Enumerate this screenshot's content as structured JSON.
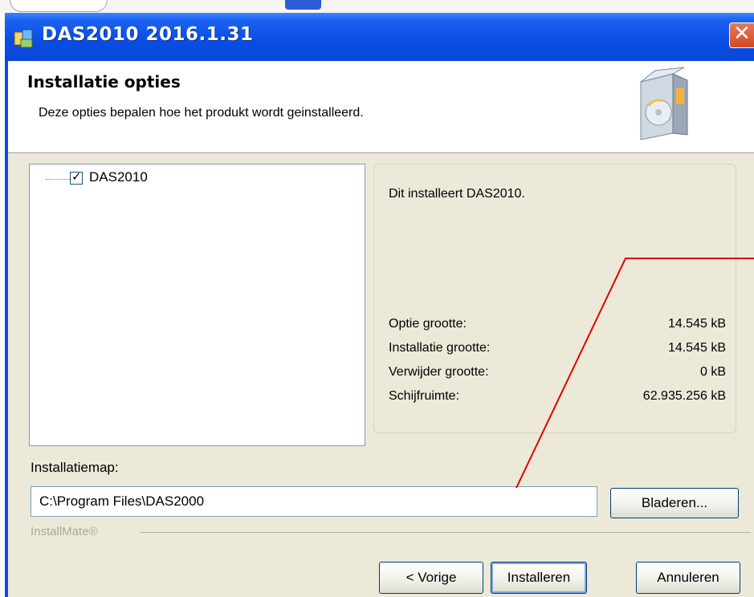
{
  "window": {
    "title": "DAS2010 2016.1.31"
  },
  "header": {
    "title": "Installatie opties",
    "subtitle": "Deze opties bepalen hoe het produkt wordt geinstalleerd."
  },
  "feature_tree": {
    "items": [
      {
        "label": "DAS2010",
        "checked": true
      }
    ]
  },
  "info": {
    "description": "Dit installeert DAS2010.",
    "rows": [
      {
        "label": "Optie grootte:",
        "value": "14.545 kB"
      },
      {
        "label": "Installatie grootte:",
        "value": "14.545 kB"
      },
      {
        "label": "Verwijder grootte:",
        "value": "0 kB"
      },
      {
        "label": "Schijfruimte:",
        "value": "62.935.256 kB"
      }
    ]
  },
  "install_dir": {
    "label": "Installatiemap:",
    "value": "C:\\Program Files\\DAS2000"
  },
  "buttons": {
    "browse": "Bladeren...",
    "previous": "< Vorige",
    "install": "Installeren",
    "cancel": "Annuleren"
  },
  "footer": {
    "brand": "InstallMate®"
  },
  "colors": {
    "titlebar": "#0a4ee6",
    "client_bg": "#ece9d8",
    "annotation_line": "#e00000"
  }
}
